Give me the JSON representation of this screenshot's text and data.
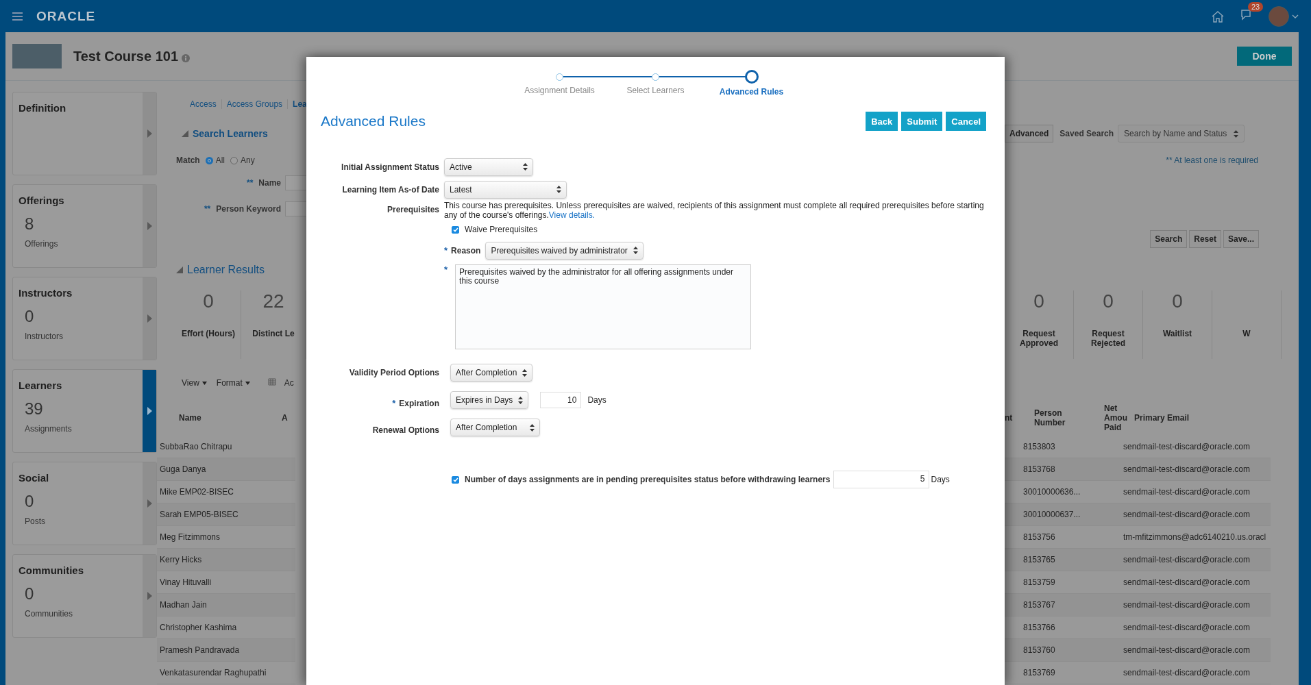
{
  "topbar": {
    "brand": "ORACLE",
    "notification_count": "23"
  },
  "course": {
    "title": "Test Course 101",
    "done_button": "Done"
  },
  "sidebar": [
    {
      "title": "Definition",
      "selected": false
    },
    {
      "title": "Offerings",
      "count": "8",
      "caption": "Offerings",
      "selected": false
    },
    {
      "title": "Instructors",
      "count": "0",
      "caption": "Instructors",
      "selected": false
    },
    {
      "title": "Learners",
      "count": "39",
      "caption": "Assignments",
      "selected": true
    },
    {
      "title": "Social",
      "count": "0",
      "caption": "Posts",
      "selected": false
    },
    {
      "title": "Communities",
      "count": "0",
      "caption": "Communities",
      "selected": false
    }
  ],
  "tabs": [
    {
      "label": "Access",
      "selected": false
    },
    {
      "label": "Access Groups",
      "selected": false
    },
    {
      "label": "Lea",
      "selected": true
    }
  ],
  "search": {
    "title": "Search Learners",
    "match_label": "Match",
    "match_options": [
      {
        "label": "All",
        "selected": true
      },
      {
        "label": "Any",
        "selected": false
      }
    ],
    "fields": [
      {
        "mark": "**",
        "label": "Name"
      },
      {
        "mark": "**",
        "label": "Person Keyword"
      }
    ],
    "advanced_button": "Advanced",
    "saved_search_label": "Saved Search",
    "saved_search_value": "Search by Name and Status",
    "required_note": "** At least one is required",
    "buttons": [
      "Search",
      "Reset",
      "Save..."
    ]
  },
  "results": {
    "title": "Learner Results",
    "stats_left": [
      {
        "value": "0",
        "label": "Effort (Hours)"
      },
      {
        "value": "22",
        "label": "Distinct Le"
      }
    ],
    "stats_right": [
      {
        "value": "0",
        "label": "Request Approved"
      },
      {
        "value": "0",
        "label": "Request Rejected"
      },
      {
        "value": "0",
        "label": "Waitlist"
      },
      {
        "label": "W"
      }
    ],
    "toolbar": [
      "View",
      "Format"
    ],
    "toolbar_cut": "Ac",
    "columns_left": [
      "Name",
      "A"
    ],
    "columns_right": [
      "nt",
      "Person Number",
      "Net Amou Paid",
      "Primary Email"
    ],
    "rows": [
      {
        "name": "SubbaRao Chitrapu",
        "person_number": "8153803",
        "email": "sendmail-test-discard@oracle.com"
      },
      {
        "name": "Guga Danya",
        "person_number": "8153768",
        "email": "sendmail-test-discard@oracle.com"
      },
      {
        "name": "Mike EMP02-BISEC",
        "person_number": "30010000636...",
        "email": "sendmail-test-discard@oracle.com"
      },
      {
        "name": "Sarah EMP05-BISEC",
        "person_number": "30010000637...",
        "email": "sendmail-test-discard@oracle.com"
      },
      {
        "name": "Meg Fitzimmons",
        "person_number": "8153756",
        "email": "tm-mfitzimmons@adc6140210.us.oracl"
      },
      {
        "name": "Kerry Hicks",
        "person_number": "8153765",
        "email": "sendmail-test-discard@oracle.com"
      },
      {
        "name": "Vinay Hituvalli",
        "person_number": "8153759",
        "email": "sendmail-test-discard@oracle.com"
      },
      {
        "name": "Madhan Jain",
        "person_number": "8153767",
        "email": "sendmail-test-discard@oracle.com"
      },
      {
        "name": "Christopher Kashima",
        "person_number": "8153766",
        "email": "sendmail-test-discard@oracle.com"
      },
      {
        "name": "Pramesh Pandravada",
        "person_number": "8153760",
        "email": "sendmail-test-discard@oracle.com"
      },
      {
        "name": "Venkatasurendar Raghupathi",
        "person_number": "8153769",
        "email": "sendmail-test-discard@oracle.com"
      }
    ]
  },
  "modal": {
    "steps": [
      {
        "label": "Assignment Details",
        "selected": false
      },
      {
        "label": "Select Learners",
        "selected": false
      },
      {
        "label": "Advanced Rules",
        "selected": true
      }
    ],
    "title": "Advanced Rules",
    "buttons": [
      "Back",
      "Submit",
      "Cancel"
    ],
    "initial_status": {
      "label": "Initial Assignment Status",
      "value": "Active"
    },
    "as_of_date": {
      "label": "Learning Item As-of Date",
      "value": "Latest"
    },
    "prerequisites": {
      "label": "Prerequisites",
      "text": "This course has prerequisites. Unless prerequisites are waived, recipients of this assignment must complete all required prerequisites before starting any of the course's offerings.",
      "link": "View details."
    },
    "waive": {
      "label": "Waive Prerequisites",
      "checked": true
    },
    "reason": {
      "mark": "*",
      "label": "Reason",
      "value": "Prerequisites waived by administrator"
    },
    "reason_text": {
      "mark": "*",
      "value": "Prerequisites waived by the administrator for all offering assignments under this course"
    },
    "validity": {
      "label": "Validity Period Options",
      "value": "After Completion"
    },
    "expiration": {
      "mark": "*",
      "label": "Expiration",
      "value": "Expires in Days",
      "days": "10",
      "unit": "Days"
    },
    "renewal": {
      "label": "Renewal Options",
      "value": "After Completion"
    },
    "pending": {
      "label": "Number of days assignments are in pending prerequisites status before withdrawing learners",
      "checked": true,
      "days": "5",
      "unit": "Days"
    }
  }
}
